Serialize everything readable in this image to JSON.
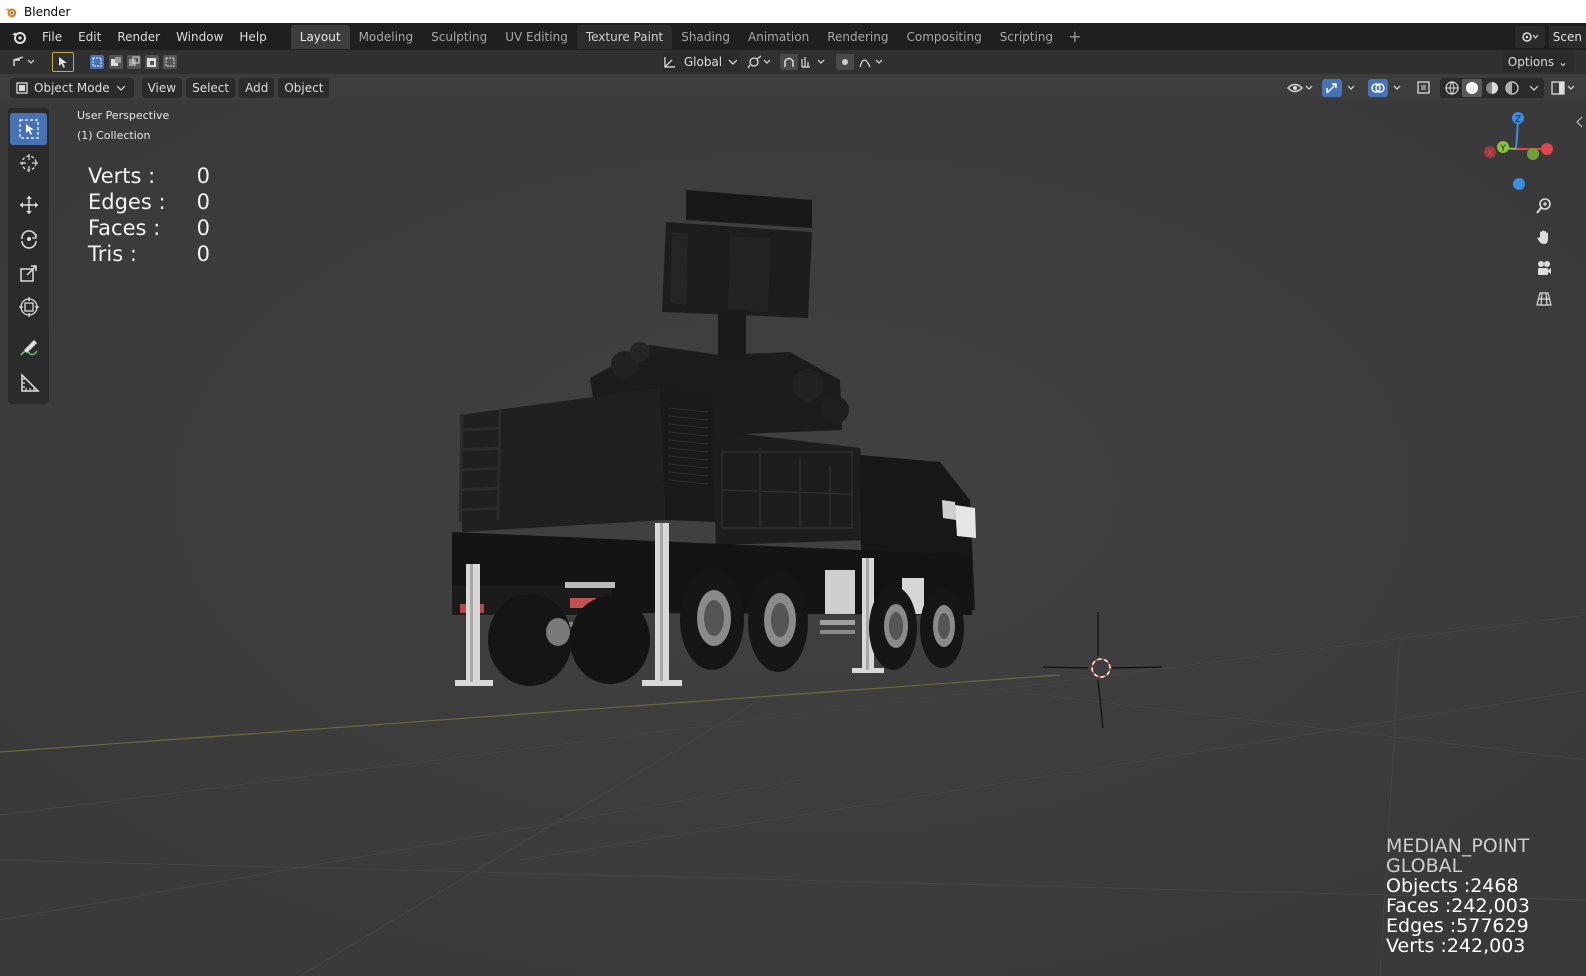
{
  "window": {
    "title": "Blender"
  },
  "menu": {
    "items": [
      "File",
      "Edit",
      "Render",
      "Window",
      "Help"
    ]
  },
  "workspace_tabs": [
    "Layout",
    "Modeling",
    "Sculpting",
    "UV Editing",
    "Texture Paint",
    "Shading",
    "Animation",
    "Rendering",
    "Compositing",
    "Scripting"
  ],
  "active_tab": "Layout",
  "scene": {
    "name": "Scen"
  },
  "toolheader": {
    "orientation": "Global",
    "options_label": "Options"
  },
  "viewport_header": {
    "mode": "Object Mode",
    "menus": [
      "View",
      "Select",
      "Add",
      "Object"
    ]
  },
  "viewport": {
    "perspective": "User Perspective",
    "collection": "(1) Collection"
  },
  "stats_overlay": [
    {
      "label": "Verts :",
      "value": "0"
    },
    {
      "label": "Edges :",
      "value": "0"
    },
    {
      "label": "Faces :",
      "value": "0"
    },
    {
      "label": "Tris :",
      "value": "0"
    }
  ],
  "bottom_stats": {
    "pivot": "MEDIAN_POINT",
    "orientation": "GLOBAL",
    "objects": "Objects :2468",
    "faces": "Faces :242,003",
    "edges": "Edges :577629",
    "verts": "Verts :242,003"
  },
  "gizmo": {
    "z": "Z",
    "y": "Y",
    "x": "X"
  },
  "colors": {
    "accent": "#4772b3",
    "background": "#3d3d3d",
    "topbar": "#1f1f1f",
    "x_axis": "#e04850",
    "y_axis": "#8cc43c",
    "z_axis": "#3c8ce0"
  }
}
